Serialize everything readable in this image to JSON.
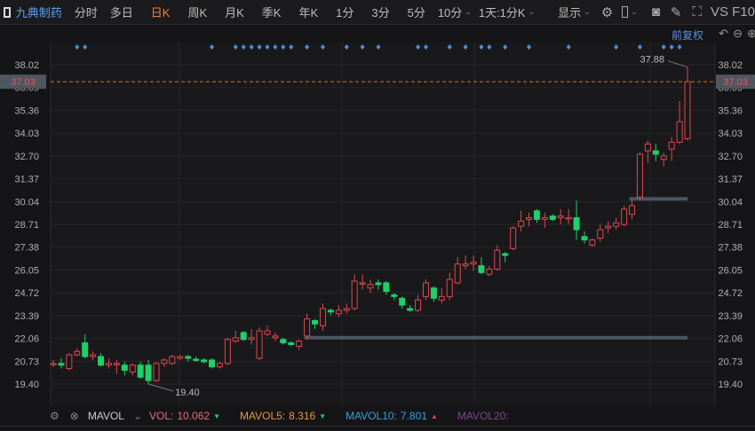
{
  "toolbar": {
    "stock_name": "九典制药",
    "periods": [
      "分时",
      "多日",
      "日K",
      "周K",
      "月K",
      "季K",
      "年K",
      "1分",
      "3分",
      "5分",
      "10分"
    ],
    "active_period": "日K",
    "multi_period": "1天:1分K",
    "display_label": "显示",
    "vs_label": "VS F10"
  },
  "subbar": {
    "adjust_label": "前复权"
  },
  "colors": {
    "up": "#e0454f",
    "down": "#1fcf6a",
    "marker": "#4b8fe0",
    "last_line": "#d2773a",
    "support": "#4a5560"
  },
  "axis": {
    "ticks": [
      "38.02",
      "36.69",
      "35.36",
      "34.03",
      "32.70",
      "31.37",
      "30.04",
      "28.71",
      "27.38",
      "26.05",
      "24.72",
      "23.39",
      "22.06",
      "20.73",
      "19.40"
    ],
    "last_price": "37.03"
  },
  "chart_data": {
    "type": "candlestick",
    "ylim": [
      19.4,
      38.02
    ],
    "high_label": "37.88",
    "low_label": "19.40",
    "last_price": 37.03,
    "support_levels": [
      {
        "price": 22.1,
        "from_index": 32
      },
      {
        "price": 30.2,
        "from_index": 73
      }
    ],
    "marker_indices": [
      3,
      4,
      20,
      23,
      24,
      25,
      26,
      27,
      28,
      29,
      30,
      32,
      34,
      37,
      39,
      41,
      46,
      47,
      50,
      52,
      54,
      55,
      57,
      60,
      65,
      71,
      74,
      77,
      78,
      79
    ],
    "ohlc": [
      [
        20.55,
        20.8,
        20.4,
        20.6
      ],
      [
        20.6,
        20.9,
        20.3,
        20.5
      ],
      [
        20.3,
        21.2,
        20.2,
        21.1
      ],
      [
        21.1,
        21.5,
        21.0,
        21.3
      ],
      [
        21.8,
        22.3,
        20.9,
        21.0
      ],
      [
        21.0,
        21.3,
        20.8,
        21.1
      ],
      [
        21.0,
        21.2,
        20.4,
        20.5
      ],
      [
        20.5,
        20.9,
        20.3,
        20.6
      ],
      [
        20.6,
        20.8,
        20.0,
        20.6
      ],
      [
        20.5,
        20.7,
        19.9,
        20.2
      ],
      [
        20.1,
        20.6,
        19.9,
        20.5
      ],
      [
        20.5,
        20.7,
        19.7,
        19.8
      ],
      [
        20.5,
        20.8,
        19.4,
        19.6
      ],
      [
        19.6,
        20.7,
        19.5,
        20.6
      ],
      [
        20.6,
        20.9,
        20.4,
        20.8
      ],
      [
        20.6,
        21.1,
        20.5,
        21.0
      ],
      [
        20.9,
        21.1,
        20.8,
        21.0
      ],
      [
        21.0,
        21.1,
        20.7,
        20.9
      ],
      [
        20.85,
        21.0,
        20.7,
        20.8
      ],
      [
        20.8,
        20.9,
        20.6,
        20.7
      ],
      [
        20.8,
        20.9,
        20.3,
        20.4
      ],
      [
        20.4,
        20.7,
        20.3,
        20.6
      ],
      [
        20.6,
        22.1,
        20.5,
        22.0
      ],
      [
        21.9,
        22.5,
        21.8,
        22.1
      ],
      [
        22.4,
        22.5,
        21.9,
        22.0
      ],
      [
        22.0,
        22.6,
        21.7,
        22.1
      ],
      [
        20.9,
        22.7,
        20.8,
        22.5
      ],
      [
        22.3,
        22.8,
        22.2,
        22.5
      ],
      [
        22.1,
        22.4,
        21.9,
        22.2
      ],
      [
        22.0,
        22.1,
        21.7,
        21.8
      ],
      [
        21.8,
        21.9,
        21.6,
        21.7
      ],
      [
        21.6,
        22.0,
        21.4,
        21.9
      ],
      [
        22.2,
        23.5,
        22.0,
        23.2
      ],
      [
        23.1,
        23.2,
        22.6,
        22.9
      ],
      [
        22.8,
        24.1,
        22.5,
        23.8
      ],
      [
        23.7,
        23.8,
        23.4,
        23.6
      ],
      [
        23.5,
        24.0,
        23.3,
        23.7
      ],
      [
        23.7,
        24.1,
        23.5,
        23.8
      ],
      [
        23.8,
        25.8,
        23.7,
        25.4
      ],
      [
        25.3,
        25.8,
        24.9,
        25.3
      ],
      [
        25.0,
        25.5,
        24.7,
        25.2
      ],
      [
        25.3,
        25.5,
        24.9,
        25.2
      ],
      [
        25.3,
        25.4,
        24.6,
        24.8
      ],
      [
        24.6,
        24.7,
        24.3,
        24.5
      ],
      [
        24.4,
        24.5,
        23.8,
        24.0
      ],
      [
        23.8,
        24.0,
        23.6,
        23.7
      ],
      [
        23.7,
        24.6,
        23.6,
        24.3
      ],
      [
        24.5,
        25.5,
        24.3,
        25.3
      ],
      [
        25.0,
        25.1,
        24.2,
        24.4
      ],
      [
        24.3,
        25.0,
        24.1,
        24.5
      ],
      [
        24.5,
        25.9,
        24.3,
        25.5
      ],
      [
        25.3,
        26.8,
        25.2,
        26.4
      ],
      [
        26.3,
        26.9,
        26.1,
        26.4
      ],
      [
        26.4,
        26.9,
        26.0,
        26.5
      ],
      [
        26.3,
        26.8,
        25.8,
        25.9
      ],
      [
        25.8,
        26.3,
        25.7,
        26.1
      ],
      [
        26.1,
        27.5,
        26.0,
        27.2
      ],
      [
        27.0,
        27.1,
        26.5,
        26.9
      ],
      [
        27.3,
        28.6,
        27.2,
        28.5
      ],
      [
        28.6,
        29.5,
        28.3,
        28.9
      ],
      [
        29.0,
        29.4,
        28.6,
        29.1
      ],
      [
        29.5,
        29.6,
        28.8,
        29.0
      ],
      [
        29.0,
        29.4,
        28.5,
        29.1
      ],
      [
        29.2,
        29.3,
        28.9,
        29.0
      ],
      [
        29.1,
        29.6,
        28.7,
        29.2
      ],
      [
        29.1,
        29.6,
        28.7,
        29.1
      ],
      [
        29.1,
        30.1,
        27.8,
        28.4
      ],
      [
        28.0,
        28.3,
        27.6,
        27.8
      ],
      [
        27.5,
        27.9,
        27.4,
        27.8
      ],
      [
        27.9,
        28.7,
        27.7,
        28.4
      ],
      [
        28.5,
        28.9,
        28.2,
        28.6
      ],
      [
        28.6,
        29.1,
        28.4,
        28.8
      ],
      [
        28.7,
        29.8,
        28.6,
        29.6
      ],
      [
        29.3,
        30.1,
        29.0,
        29.8
      ],
      [
        30.3,
        32.9,
        30.1,
        32.8
      ],
      [
        33.0,
        33.6,
        32.3,
        33.4
      ],
      [
        33.0,
        33.4,
        32.4,
        32.8
      ],
      [
        32.5,
        32.9,
        32.1,
        32.7
      ],
      [
        33.1,
        33.8,
        32.4,
        33.5
      ],
      [
        33.5,
        35.9,
        33.4,
        34.7
      ],
      [
        33.7,
        37.88,
        33.6,
        37.03
      ]
    ]
  },
  "footer": {
    "indicator": "MAVOL",
    "vol_label": "VOL:",
    "vol_value": "10.062",
    "mavol5_label": "MAVOL5:",
    "mavol5_value": "8.316",
    "mavol10_label": "MAVOL10:",
    "mavol10_value": "7.801",
    "mavol20_label": "MAVOL20:"
  }
}
